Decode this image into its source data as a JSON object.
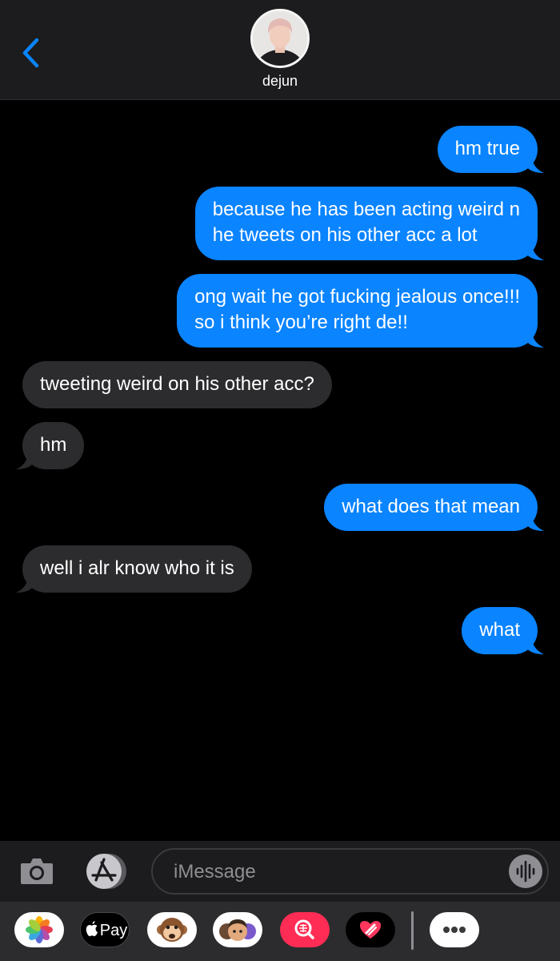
{
  "header": {
    "contact_name": "dejun"
  },
  "messages": [
    {
      "from": "me",
      "lines": [
        "hm true"
      ]
    },
    {
      "from": "me",
      "lines": [
        "because he has been acting weird n",
        "he tweets on his other acc a lot"
      ]
    },
    {
      "from": "me",
      "lines": [
        "ong wait he got fucking jealous once!!!",
        "so i think you’re right de!!"
      ]
    },
    {
      "from": "them",
      "lines": [
        "tweeting weird on his other acc?"
      ]
    },
    {
      "from": "them",
      "lines": [
        "hm"
      ]
    },
    {
      "from": "me",
      "lines": [
        "what does that mean"
      ]
    },
    {
      "from": "them",
      "lines": [
        "well i alr know who it is"
      ]
    },
    {
      "from": "me",
      "lines": [
        "what"
      ]
    }
  ],
  "input": {
    "placeholder": "iMessage",
    "value": ""
  },
  "app_drawer": {
    "apple_pay_label": "Pay",
    "icons": [
      "photos-icon",
      "apple-pay-icon",
      "animoji-icon",
      "memoji-icon",
      "image-search-icon",
      "digital-touch-icon",
      "more-apps-icon"
    ]
  },
  "colors": {
    "sent_bubble": "#0a84ff",
    "received_bubble": "#2c2c2e",
    "accent": "#0a84ff",
    "background": "#000000"
  }
}
